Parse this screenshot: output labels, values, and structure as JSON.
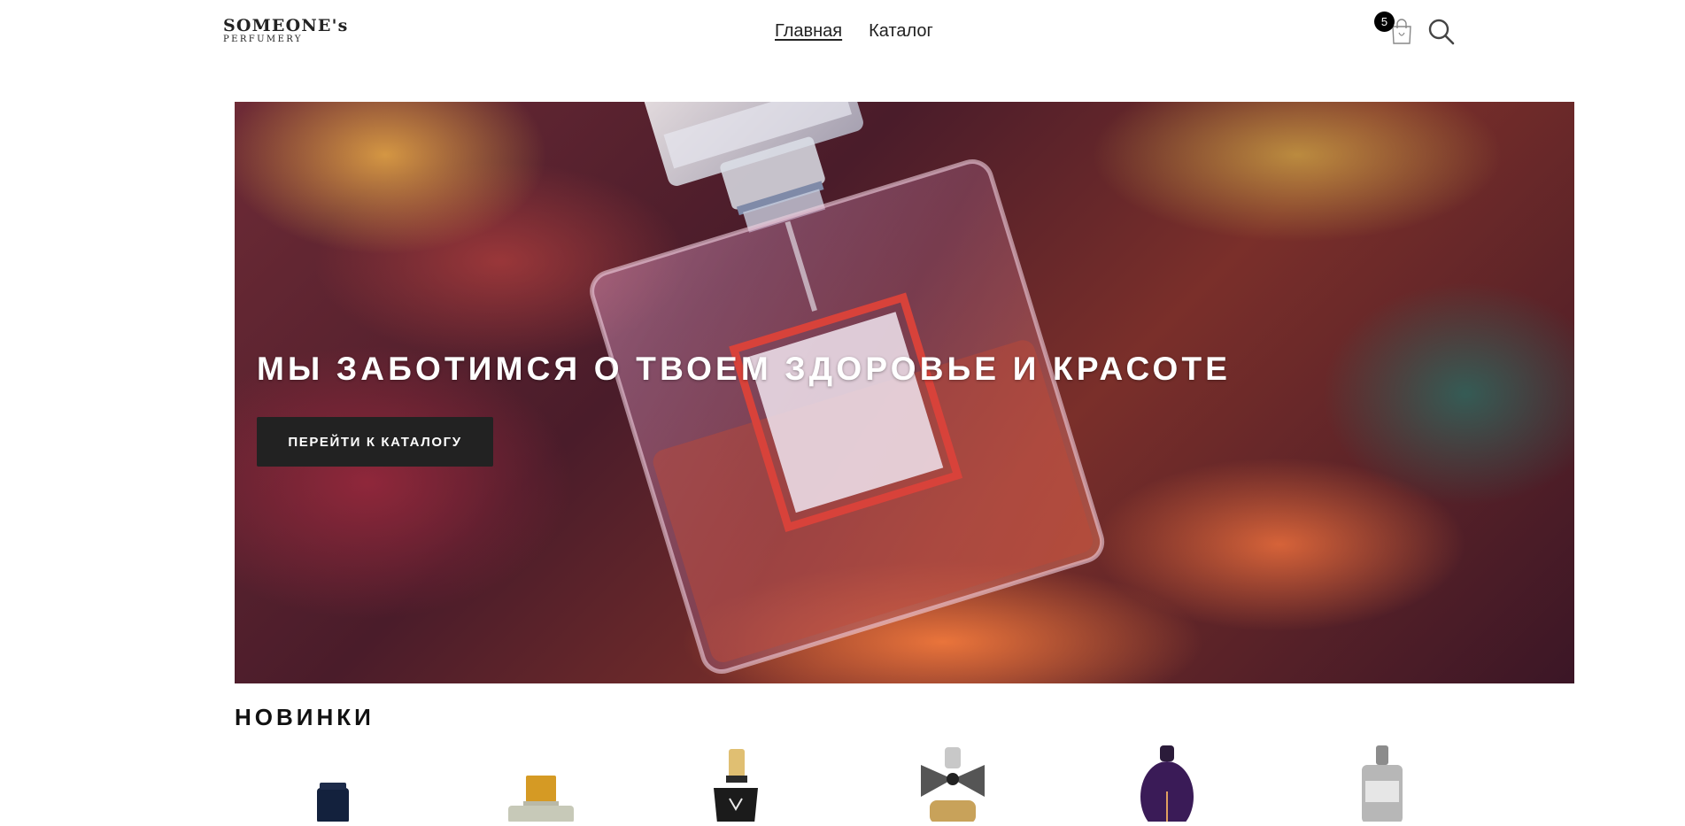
{
  "header": {
    "logo_main": "SOMEONE's",
    "logo_sub": "PERFUMERY",
    "nav": [
      {
        "label": "Главная",
        "active": true
      },
      {
        "label": "Каталог",
        "active": false
      }
    ],
    "cart_count": "5",
    "icons": {
      "cart": "shopping-bag-icon",
      "search": "search-icon"
    }
  },
  "hero": {
    "title": "МЫ ЗАБОТИМСЯ О ТВОЕМ ЗДОРОВЬЕ И КРАСОТЕ",
    "button_label": "ПЕРЕЙТИ К КАТАЛОГУ"
  },
  "new_arrivals": {
    "title": "НОВИНКИ",
    "products": [
      {
        "icon": "perfume-bottle-dark-blue"
      },
      {
        "icon": "perfume-bottle-gold-cap"
      },
      {
        "icon": "perfume-bottle-black-gold"
      },
      {
        "icon": "perfume-bottle-bow-cap"
      },
      {
        "icon": "perfume-bottle-purple"
      },
      {
        "icon": "perfume-bottle-silver"
      }
    ]
  },
  "colors": {
    "text": "#222222",
    "button_bg": "#222222",
    "badge_bg": "#000000"
  }
}
